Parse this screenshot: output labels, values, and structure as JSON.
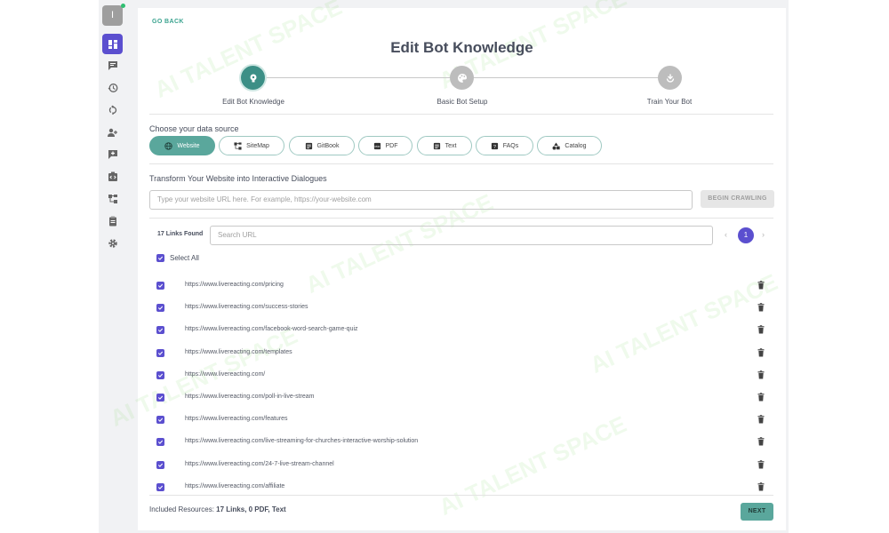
{
  "sidebar": {
    "avatar_initial": "I",
    "items": [
      {
        "icon": "dashboard-icon",
        "active": true
      },
      {
        "icon": "chat-icon",
        "active": false
      },
      {
        "icon": "history-icon",
        "active": false
      },
      {
        "icon": "sync-icon",
        "active": false
      },
      {
        "icon": "users-icon",
        "active": false
      },
      {
        "icon": "add-comment-icon",
        "active": false
      },
      {
        "icon": "code-icon",
        "active": false
      },
      {
        "icon": "sitemap-icon",
        "active": false
      },
      {
        "icon": "clipboard-icon",
        "active": false
      },
      {
        "icon": "gear-icon",
        "active": false
      }
    ]
  },
  "header": {
    "go_back": "GO BACK",
    "title": "Edit Bot Knowledge"
  },
  "stepper": {
    "steps": [
      {
        "label": "Edit Bot Knowledge",
        "state": "current"
      },
      {
        "label": "Basic Bot Setup",
        "state": "pending"
      },
      {
        "label": "Train Your Bot",
        "state": "pending"
      }
    ]
  },
  "source": {
    "label": "Choose your data source",
    "chips": [
      {
        "label": "Website",
        "icon": "globe-icon",
        "active": true
      },
      {
        "label": "SiteMap",
        "icon": "sitemap-icon",
        "active": false
      },
      {
        "label": "GitBook",
        "icon": "book-icon",
        "active": false
      },
      {
        "label": "PDF",
        "icon": "pdf-icon",
        "active": false
      },
      {
        "label": "Text",
        "icon": "text-icon",
        "active": false
      },
      {
        "label": "FAQs",
        "icon": "faq-icon",
        "active": false
      },
      {
        "label": "Catalog",
        "icon": "shapes-icon",
        "active": false
      }
    ]
  },
  "website": {
    "heading": "Transform Your Website into Interactive Dialogues",
    "url_placeholder": "Type your website URL here. For example, https://your-website.com",
    "crawl_button": "BEGIN CRAWLING"
  },
  "links": {
    "found_label": "17 Links Found",
    "search_placeholder": "Search URL",
    "current_page": "1",
    "prev_arrow": "‹",
    "next_arrow": "›",
    "select_all_label": "Select All",
    "items": [
      "https://www.livereacting.com/pricing",
      "https://www.livereacting.com/success-stories",
      "https://www.livereacting.com/facebook-word-search-game-quiz",
      "https://www.livereacting.com/templates",
      "https://www.livereacting.com/",
      "https://www.livereacting.com/poll-in-live-stream",
      "https://www.livereacting.com/features",
      "https://www.livereacting.com/live-streaming-for-churches-interactive-worship-solution",
      "https://www.livereacting.com/24-7-live-stream-channel",
      "https://www.livereacting.com/affiliate"
    ]
  },
  "footer": {
    "resources_label": "Included Resources:",
    "resources_value": "17 Links, 0 PDF, Text",
    "next_button": "NEXT"
  },
  "watermark": "AI TALENT SPACE",
  "colors": {
    "primary_purple": "#5b4fcf",
    "accent_teal": "#5aa79c",
    "step_done": "#3c8f86"
  }
}
